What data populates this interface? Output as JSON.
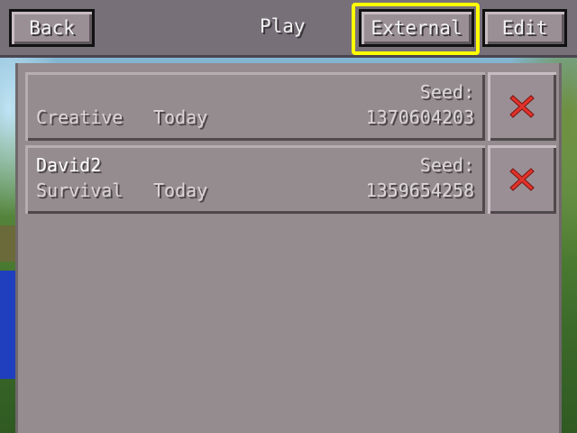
{
  "header": {
    "back_label": "Back",
    "play_label": "Play",
    "external_label": "External",
    "edit_label": "Edit"
  },
  "worlds": [
    {
      "name": "",
      "mode": "Creative",
      "date": "Today",
      "seed_label": "Seed:",
      "seed": "1370604203"
    },
    {
      "name": "David2",
      "mode": "Survival",
      "date": "Today",
      "seed_label": "Seed:",
      "seed": "1359654258"
    }
  ],
  "icons": {
    "delete": "close-icon"
  },
  "colors": {
    "highlight": "#ffff00",
    "delete_x": "#e0322a",
    "panel": "#958c8f",
    "header": "#777079"
  }
}
